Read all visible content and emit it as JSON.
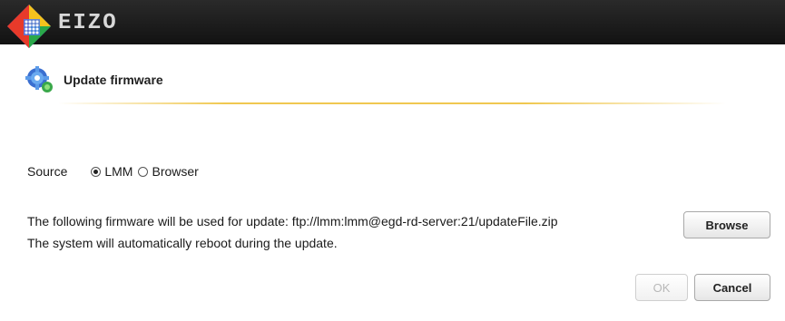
{
  "header": {
    "brand": "EIZO",
    "logo_icon": "eizo-diamond-logo"
  },
  "section": {
    "title": "Update firmware",
    "icon": "gear-icon"
  },
  "source": {
    "label": "Source",
    "options": [
      {
        "label": "LMM",
        "selected": true
      },
      {
        "label": "Browser",
        "selected": false
      }
    ]
  },
  "message": {
    "line1": "The following firmware will be used for update: ftp://lmm:lmm@egd-rd-server:21/updateFile.zip",
    "line2": "The system will automatically reboot during the update."
  },
  "buttons": {
    "browse": "Browse",
    "ok": "OK",
    "cancel": "Cancel"
  },
  "colors": {
    "topbar": "#1a1a1a",
    "divider": "#f0c850"
  }
}
